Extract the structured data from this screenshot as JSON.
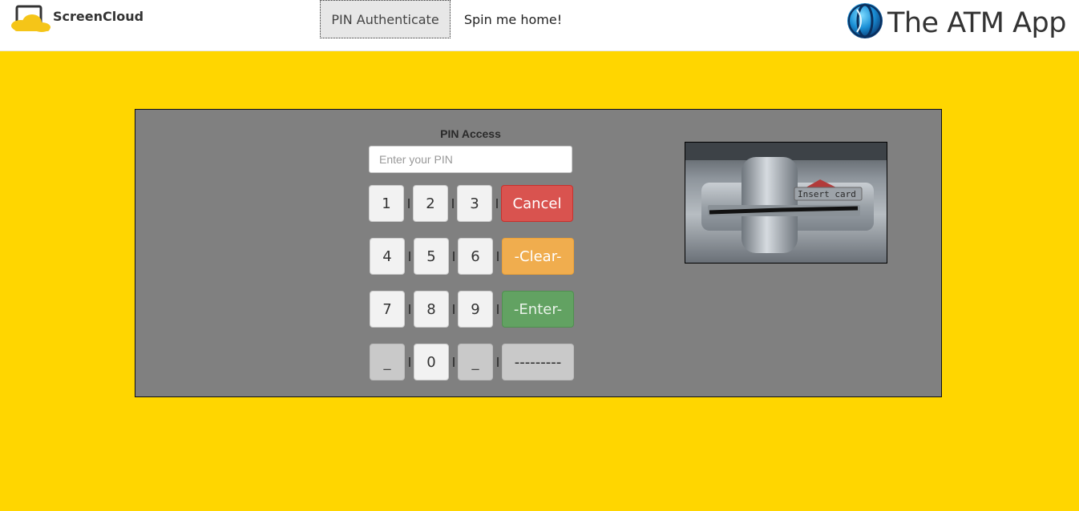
{
  "navbar": {
    "brand_name": "ScreenCloud",
    "links": [
      {
        "label": "PIN Authenticate",
        "active": true
      },
      {
        "label": "Spin me home!",
        "active": false
      }
    ],
    "app_title": "The ATM App",
    "app_logo_icon": "globe-logo-icon"
  },
  "atm": {
    "pin_label": "PIN Access",
    "pin_input": {
      "value": "",
      "placeholder": "Enter your PIN"
    },
    "keypad": {
      "rows": [
        {
          "keys": [
            "1",
            "2",
            "3"
          ],
          "action": "Cancel"
        },
        {
          "keys": [
            "4",
            "5",
            "6"
          ],
          "action": "-Clear-"
        },
        {
          "keys": [
            "7",
            "8",
            "9"
          ],
          "action": "-Enter-"
        },
        {
          "keys": [
            "_",
            "0",
            "_"
          ],
          "action": "---------"
        }
      ]
    },
    "card_slot_text": "Insert card"
  },
  "colors": {
    "background": "#ffd600",
    "panel": "#808080",
    "cancel": "#d9534f",
    "clear": "#f0ad4e",
    "enter": "#62a262"
  }
}
